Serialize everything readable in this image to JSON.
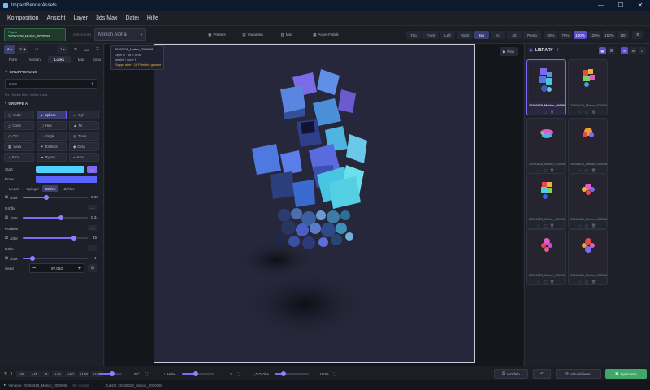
{
  "window": {
    "title": "ImpactRenderAssets",
    "minimize": "—",
    "maximize": "☐",
    "close": "✕"
  },
  "menu": [
    "Komposition",
    "Ansicht",
    "Layer",
    "3ds Max",
    "Datei",
    "Hilfe"
  ],
  "toolbar": {
    "project_label": "Projekt",
    "project_value": "20260428_Motion_0000068",
    "speichern_label": "SPEICHERN",
    "motion_select": "Motion Alpha",
    "tabs": [
      "Presets",
      "Varianten",
      "Max",
      "Asset-Fabrik"
    ],
    "views": [
      "Top",
      "Front",
      "Left",
      "Right",
      "Iso",
      "Ko",
      "Alt",
      "Persp"
    ],
    "zooms": [
      "50%",
      "75%",
      "100%",
      "125%",
      "150%",
      "100"
    ]
  },
  "left": {
    "mode_buttons": [
      "A ▸",
      "S ◆",
      "↺",
      "1 ▸",
      "↻",
      "Le"
    ],
    "tabs": [
      "Form",
      "Motion",
      "Looks",
      "Max",
      "Expo"
    ],
    "gruppierung": "GRUPPIERUNG",
    "grouping_value": "none",
    "hint": "Für Objekte führe Motion A aus",
    "gruppe": "GRUPPE A",
    "shapes": [
      "Cube",
      "Sphere",
      "Cyl",
      "Cone",
      "Hex",
      "Tri",
      "Oct",
      "Ringle",
      "Torus",
      "Voxa",
      "Einflicts",
      "Octa",
      "Slice",
      "Pyram",
      "Knot"
    ],
    "start_label": "Start",
    "ende_label": "Ende",
    "gradient_tabs": [
      "Linear",
      "Spiegel",
      "Stufen",
      "Zyklus"
    ],
    "jitter_label": "Jitter",
    "jitter_value": "0.32",
    "groesse_label": "Größe",
    "groesse_jitter": "Jitter",
    "groesse_value": "0.31",
    "position_label": "Position",
    "position_jitter": "Jitter",
    "position_value": "45",
    "hoehe_label": "Höhe",
    "hoehe_jitter": "Jitter",
    "hoehe_value": "1",
    "seed_label": "Seed",
    "seed_value": "97.053",
    "start_color": "#4fd0ff",
    "ende_color": "#5b63ff",
    "accent": "#7d6cf2"
  },
  "viewport": {
    "overlay_title": "20260428_Motion_0000068",
    "overlay_l1": "Layer A · 58 × circle",
    "overlay_l2": "Idealist / none 6",
    "overlay_l3": "Etappe alter · 15 Primitive gesamt",
    "play": "Play"
  },
  "library": {
    "title": "LIBRARY",
    "count": "8",
    "items": [
      {
        "label": "20260428_Motion_0000068",
        "selected": true
      },
      {
        "label": "20260428_Motion_0000067",
        "selected": false
      },
      {
        "label": "20260428_Motion_0000066",
        "selected": false
      },
      {
        "label": "20260428_Motion_0000065",
        "selected": false
      },
      {
        "label": "20260428_Motion_0000064",
        "selected": false
      },
      {
        "label": "20260428_Motion_0000063",
        "selected": false
      },
      {
        "label": "20260428_Motion_0000062",
        "selected": false
      },
      {
        "label": "20260428_Motion_0000061",
        "selected": false
      }
    ]
  },
  "bottom": {
    "rot_value": "2",
    "steps": [
      "-90",
      "-45",
      "0",
      "+45",
      "+90",
      "+180",
      "+180"
    ],
    "angle": "35°",
    "hoehe": "Höhe",
    "hoehe_val": "1",
    "groesse": "Größe",
    "groesse_val": "100%",
    "wuerfeln": "Würfeln",
    "aktualisieren": "Aktualisieren",
    "speichern": "Speichern"
  },
  "status": {
    "variant": "Variante: 20260428_Motion_0000068",
    "info": "90 × circle",
    "save": "Zuletzt: 20260428_Motion_0000068"
  }
}
